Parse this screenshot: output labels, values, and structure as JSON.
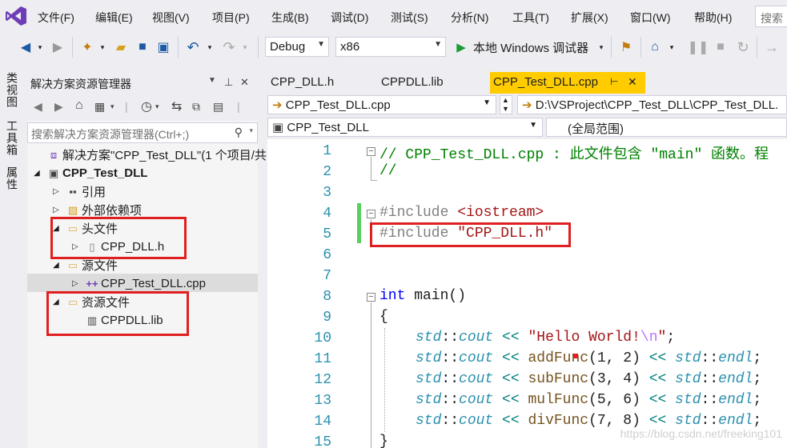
{
  "menu": [
    "文件(F)",
    "编辑(E)",
    "视图(V)",
    "项目(P)",
    "生成(B)",
    "调试(D)",
    "测试(S)",
    "分析(N)",
    "工具(T)",
    "扩展(X)",
    "窗口(W)",
    "帮助(H)"
  ],
  "search_label": "搜索",
  "toolbar": {
    "config": "Debug",
    "platform": "x86",
    "run_label": "本地 Windows 调试器"
  },
  "left_strip": [
    "类视图",
    "工具箱",
    "属性"
  ],
  "solution_explorer": {
    "title": "解决方案资源管理器",
    "search_placeholder": "搜索解决方案资源管理器(Ctrl+;)",
    "tree": [
      {
        "label": "解决方案\"CPP_Test_DLL\"(1 个项目/共",
        "icon": "solution-icon"
      },
      {
        "label": "CPP_Test_DLL",
        "icon": "project-icon"
      },
      {
        "label": "引用",
        "icon": "references-icon"
      },
      {
        "label": "外部依赖项",
        "icon": "external-deps-icon"
      },
      {
        "label": "头文件",
        "icon": "folder-icon"
      },
      {
        "label": "CPP_DLL.h",
        "icon": "header-file-icon"
      },
      {
        "label": "源文件",
        "icon": "folder-icon"
      },
      {
        "label": "CPP_Test_DLL.cpp",
        "icon": "cpp-file-icon"
      },
      {
        "label": "资源文件",
        "icon": "folder-icon"
      },
      {
        "label": "CPPDLL.lib",
        "icon": "lib-file-icon"
      }
    ]
  },
  "tabs": [
    "CPP_DLL.h",
    "CPPDLL.lib",
    "CPP_Test_DLL.cpp"
  ],
  "nav": {
    "file": "CPP_Test_DLL.cpp",
    "path": "D:\\VSProject\\CPP_Test_DLL\\CPP_Test_DLL.",
    "project": "CPP_Test_DLL",
    "scope": "(全局范围)"
  },
  "code": {
    "line_numbers": [
      "1",
      "2",
      "3",
      "4",
      "5",
      "6",
      "7",
      "8",
      "9",
      "10",
      "11",
      "12",
      "13",
      "14",
      "15"
    ],
    "l1": "// CPP_Test_DLL.cpp : 此文件包含 \"main\" 函数。程",
    "l2": "//",
    "l4_kw": "#include ",
    "l4_arg": "<iostream>",
    "l5_kw": "#include ",
    "l5_arg": "\"CPP_DLL.h\"",
    "l8_kw": "int",
    "l8_rest": " main()",
    "l9": "{",
    "l15": "}",
    "std": "std",
    "cout": "cout",
    "endl": "endl",
    "hello_str": "\"Hello World!",
    "hello_esc": "\\n",
    "hello_end": "\"",
    "calls": [
      {
        "fn": "addFunc",
        "args": "(1, 2)"
      },
      {
        "fn": "subFunc",
        "args": "(3, 4)"
      },
      {
        "fn": "mulFunc",
        "args": "(5, 6)"
      },
      {
        "fn": "divFunc",
        "args": "(7, 8)"
      }
    ]
  },
  "watermark": "https://blog.csdn.net/freeking101"
}
